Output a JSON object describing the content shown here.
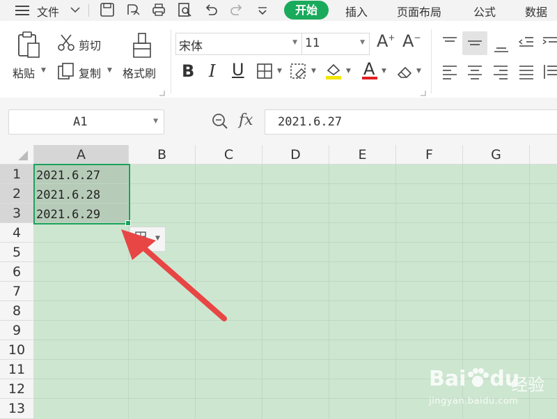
{
  "menubar": {
    "file_label": "文件",
    "tabs": [
      "开始",
      "插入",
      "页面布局",
      "公式",
      "数据"
    ]
  },
  "ribbon": {
    "paste_label": "粘贴",
    "cut_label": "剪切",
    "copy_label": "复制",
    "format_painter_label": "格式刷",
    "font_name": "宋体",
    "font_size": "11",
    "bold": "B",
    "italic": "I",
    "underline": "U",
    "font_color_letter": "A",
    "grow_font": "A",
    "shrink_font": "A"
  },
  "formula_bar": {
    "name_box": "A1",
    "fx_label": "fx",
    "value": "2021.6.27"
  },
  "sheet": {
    "columns": [
      "A",
      "B",
      "C",
      "D",
      "E",
      "F",
      "G"
    ],
    "rows": [
      "1",
      "2",
      "3",
      "4",
      "5",
      "6",
      "7",
      "8",
      "9",
      "10",
      "11",
      "12",
      "13"
    ],
    "cells": [
      "2021.6.27",
      "2021.6.28",
      "2021.6.29"
    ]
  },
  "watermark": {
    "brand": "Bai",
    "brand_tail": "du",
    "product": "经验",
    "url": "jingyan.baidu.com"
  },
  "colors": {
    "accent": "#1aaa5b",
    "sheet_background": "#cde6d0",
    "arrow": "#e84545",
    "font_color_bar": "#e02020",
    "highlight_bar": "#f5e600"
  }
}
